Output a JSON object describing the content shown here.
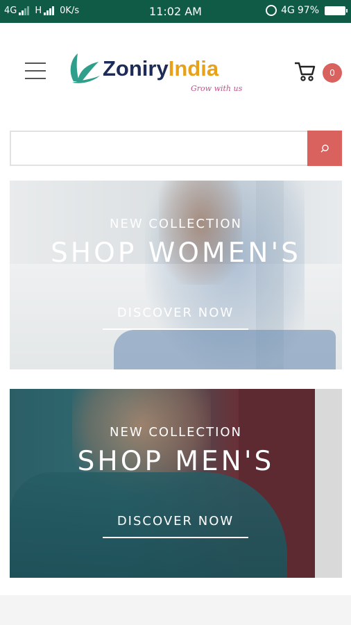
{
  "status_bar": {
    "network_left": "4G",
    "network_mid": "H",
    "data_speed": "0K/s",
    "time": "11:02 AM",
    "network_right": "4G",
    "battery": "97%"
  },
  "header": {
    "logo_part1": "Zoniry",
    "logo_part2": "India",
    "tagline": "Grow with us",
    "cart_count": "0",
    "brand_colors": {
      "navy": "#1d2b57",
      "gold": "#e8a21a",
      "leaf": "#2f9e8a",
      "accent": "#d9625f"
    }
  },
  "search": {
    "placeholder": "",
    "value": ""
  },
  "banners": [
    {
      "subtitle": "NEW COLLECTION",
      "title": "SHOP WOMEN'S",
      "cta": "DISCOVER NOW"
    },
    {
      "subtitle": "NEW COLLECTION",
      "title": "SHOP MEN'S",
      "cta": "DISCOVER NOW"
    }
  ]
}
